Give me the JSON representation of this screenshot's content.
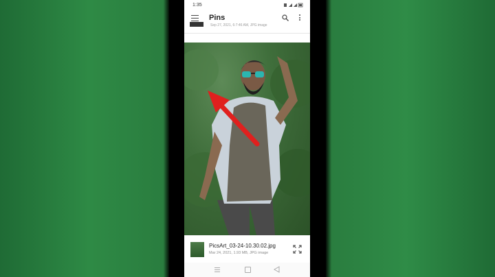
{
  "status_bar": {
    "time": "1:35",
    "icons_text": "⬤ ⧫ ▐"
  },
  "app_bar": {
    "title": "Pins"
  },
  "previous_item": {
    "meta": "Sep 27, 2021, 6:7:46 AM, JPG image"
  },
  "photo": {
    "description_icon": "image"
  },
  "file_card": {
    "filename": "PicsArt_03-24-10.30.02.jpg",
    "meta": "Mar 24, 2021, 1.93 MB, JPG image"
  },
  "colors": {
    "background_green": "#2e8a45",
    "arrow_red": "#e0201e",
    "text_primary": "#222222",
    "text_secondary": "#888888"
  }
}
